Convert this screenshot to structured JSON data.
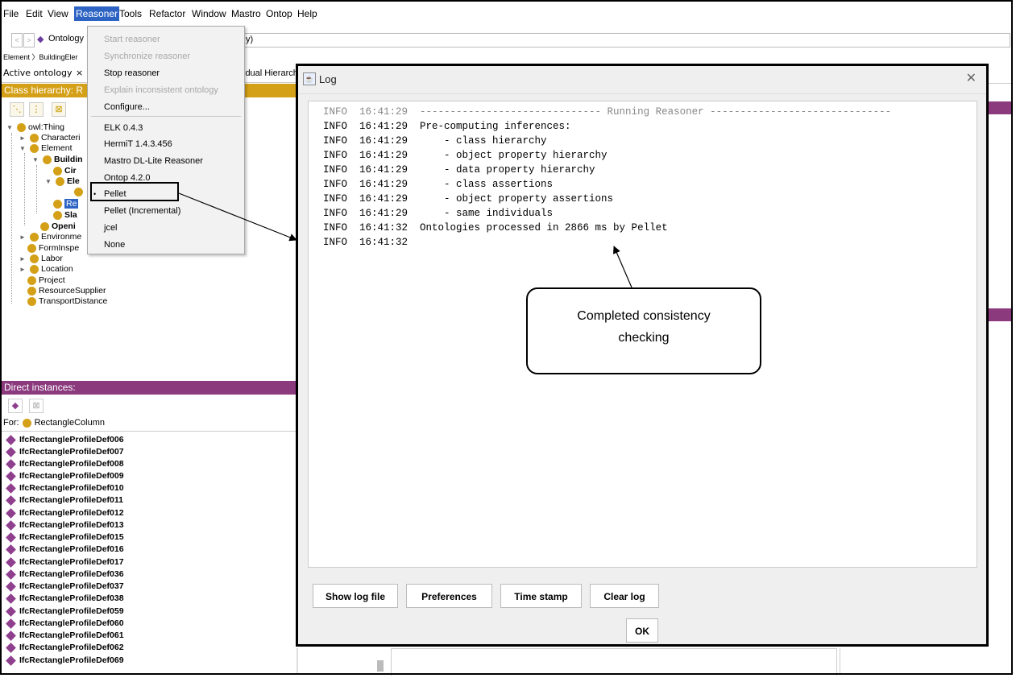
{
  "menubar": {
    "items": [
      "File",
      "Edit",
      "View",
      "Reasoner",
      "Tools",
      "Refactor",
      "Window",
      "Mastro",
      "Ontop",
      "Help"
    ],
    "open_item": "Reasoner"
  },
  "navbar": {
    "ontology_label": "Ontology",
    "address_suffix": "y)",
    "breadcrumb": "Element 〉BuildingEler"
  },
  "tabs": {
    "active_ontology": "Active ontology",
    "close_glyph": "×",
    "individual_hierarchy": "idual Hierarch"
  },
  "class_hierarchy": {
    "header": "Class hierarchy: R",
    "nodes": {
      "owl_thing": "owl:Thing",
      "characteristic": "Characteri",
      "element": "Element",
      "building": "Buildin",
      "cir": "Cir",
      "ele": "Ele",
      "rectangle": "Re",
      "slab": "Sla",
      "opening": "Openi",
      "environment": "Environme",
      "forminspection": "FormInspe",
      "labor": "Labor",
      "location": "Location",
      "project": "Project",
      "resource_supplier": "ResourceSupplier",
      "transport_distance": "TransportDistance"
    }
  },
  "direct_instances": {
    "header": "Direct instances:",
    "for_label": "For:",
    "for_class": "RectangleColumn",
    "items": [
      "IfcRectangleProfileDef006",
      "IfcRectangleProfileDef007",
      "IfcRectangleProfileDef008",
      "IfcRectangleProfileDef009",
      "IfcRectangleProfileDef010",
      "IfcRectangleProfileDef011",
      "IfcRectangleProfileDef012",
      "IfcRectangleProfileDef013",
      "IfcRectangleProfileDef015",
      "IfcRectangleProfileDef016",
      "IfcRectangleProfileDef017",
      "IfcRectangleProfileDef036",
      "IfcRectangleProfileDef037",
      "IfcRectangleProfileDef038",
      "IfcRectangleProfileDef059",
      "IfcRectangleProfileDef060",
      "IfcRectangleProfileDef061",
      "IfcRectangleProfileDef062",
      "IfcRectangleProfileDef069"
    ]
  },
  "reasoner_menu": {
    "start": "Start reasoner",
    "synchronize": "Synchronize reasoner",
    "stop": "Stop reasoner",
    "explain": "Explain inconsistent ontology",
    "configure": "Configure...",
    "reasoners": [
      "ELK 0.4.3",
      "HermiT 1.4.3.456",
      "Mastro DL-Lite Reasoner",
      "Ontop 4.2.0",
      "Pellet",
      "Pellet (Incremental)",
      "jcel",
      "None"
    ],
    "selected": "Pellet",
    "bullet": "•"
  },
  "log_window": {
    "title": "Log",
    "close_glyph": "✕",
    "lines": [
      "INFO  16:41:29  ------------------------------ Running Reasoner ------------------------------",
      "INFO  16:41:29  Pre-computing inferences:",
      "INFO  16:41:29      - class hierarchy",
      "INFO  16:41:29      - object property hierarchy",
      "INFO  16:41:29      - data property hierarchy",
      "INFO  16:41:29      - class assertions",
      "INFO  16:41:29      - object property assertions",
      "INFO  16:41:29      - same individuals",
      "INFO  16:41:32  Ontologies processed in 2866 ms by Pellet",
      "INFO  16:41:32"
    ],
    "buttons": {
      "show_log_file": "Show log file",
      "preferences": "Preferences",
      "time_stamp": "Time stamp",
      "clear_log": "Clear log",
      "ok": "OK"
    }
  },
  "callout": {
    "line1": "Completed consistency",
    "line2": "checking"
  },
  "colors": {
    "class_header": "#d4a017",
    "instances_header": "#8b3a7e",
    "selection": "#2d64c4",
    "class_dot": "#d4a017",
    "individual_diamond": "#8e3f8e"
  }
}
